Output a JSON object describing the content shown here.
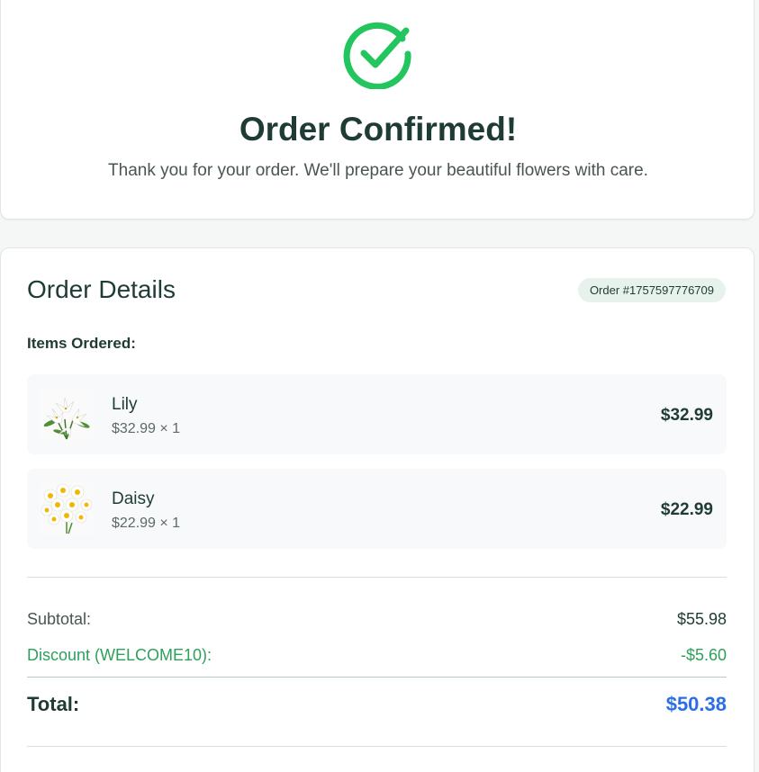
{
  "confirmation": {
    "title": "Order Confirmed!",
    "subtitle": "Thank you for your order. We'll prepare your beautiful flowers with care.",
    "icon": "check-circle-icon",
    "accent_color": "#22c55e"
  },
  "order_details": {
    "title": "Order Details",
    "order_number": "Order #1757597776709",
    "items_label": "Items Ordered:",
    "items": [
      {
        "name": "Lily",
        "unit_line": "$32.99 × 1",
        "line_total": "$32.99",
        "image": "lily-bouquet"
      },
      {
        "name": "Daisy",
        "unit_line": "$22.99 × 1",
        "line_total": "$22.99",
        "image": "daisy-bouquet"
      }
    ]
  },
  "summary": {
    "subtotal_label": "Subtotal:",
    "subtotal_value": "$55.98",
    "discount_label": "Discount (WELCOME10):",
    "discount_value": "-$5.60",
    "total_label": "Total:",
    "total_value": "$50.38",
    "discount_color": "#2da15a",
    "total_color": "#2b6fe6"
  }
}
